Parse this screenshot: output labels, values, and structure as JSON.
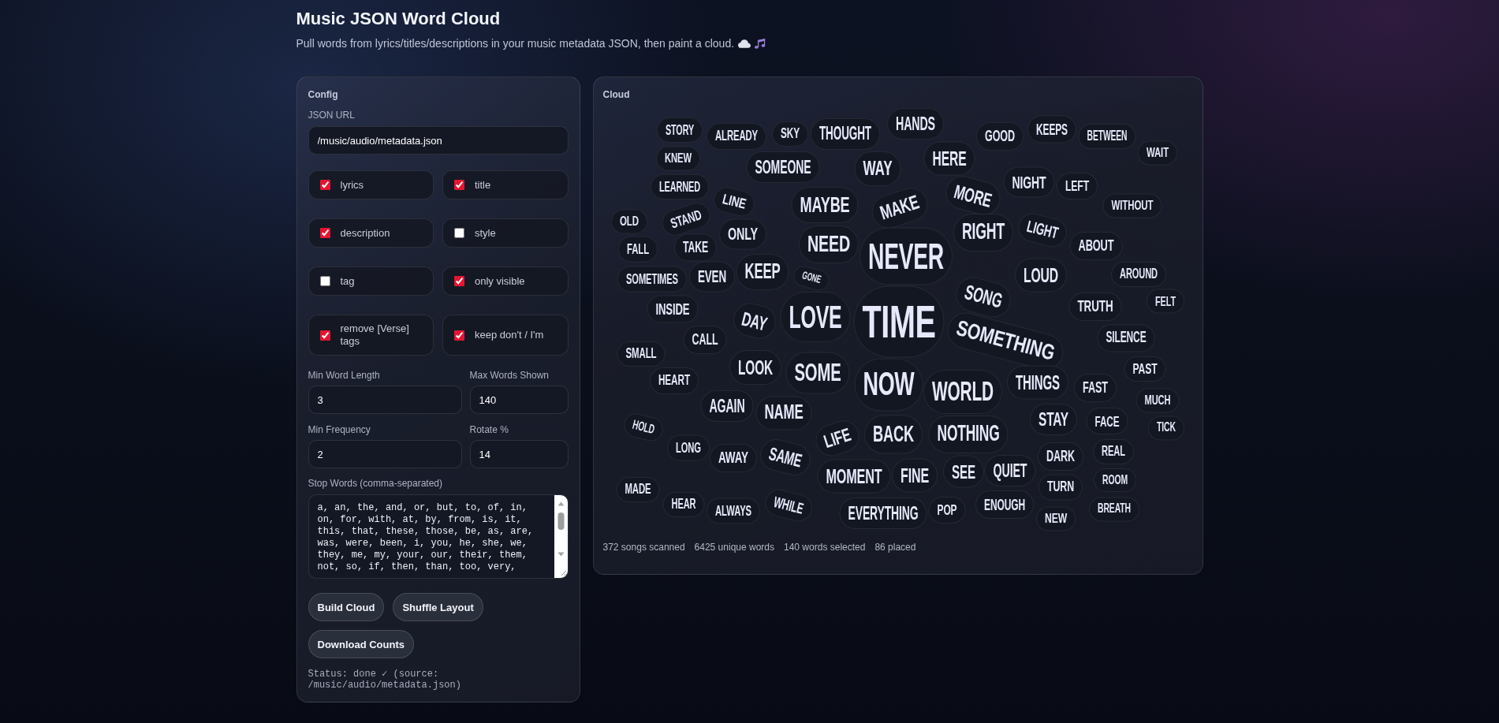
{
  "header": {
    "title": "Music JSON Word Cloud",
    "subtitle": "Pull words from lyrics/titles/descriptions in your music metadata JSON, then paint a cloud."
  },
  "config": {
    "title": "Config",
    "url": {
      "label": "JSON URL",
      "value": "/music/audio/metadata.json"
    },
    "options": [
      {
        "label": "lyrics",
        "checked": true
      },
      {
        "label": "title",
        "checked": true
      },
      {
        "label": "description",
        "checked": true
      },
      {
        "label": "style",
        "checked": false
      },
      {
        "label": "tag",
        "checked": false
      },
      {
        "label": "only visible",
        "checked": true
      },
      {
        "label": "remove [Verse] tags",
        "checked": true
      },
      {
        "label": "keep don't / I'm",
        "checked": true
      }
    ],
    "fields": [
      {
        "label": "Min Word Length",
        "value": "3"
      },
      {
        "label": "Max Words Shown",
        "value": "140"
      },
      {
        "label": "Min Frequency",
        "value": "2"
      },
      {
        "label": "Rotate %",
        "value": "14"
      }
    ],
    "stop_words": {
      "label": "Stop Words (comma-separated)",
      "value": "a, an, the, and, or, but, to, of, in, on, for, with, at, by, from, is, it, this, that, these, those, be, as, are, was, were, been, i, you, he, she, we, they, me, my, your, our, their, them, not, so, if, then, than, too, very,"
    },
    "buttons": [
      "Build Cloud",
      "Shuffle Layout",
      "Download Counts"
    ],
    "status": "Status: done ✓ (source: /music/audio/metadata.json)"
  },
  "cloud": {
    "title": "Cloud",
    "words": [
      {
        "text": "STORY",
        "rotated": false
      },
      {
        "text": "ALREADY",
        "rotated": false
      },
      {
        "text": "SKY",
        "rotated": false
      },
      {
        "text": "THOUGHT",
        "rotated": false
      },
      {
        "text": "HANDS",
        "rotated": false
      },
      {
        "text": "GOOD",
        "rotated": false
      },
      {
        "text": "KEEPS",
        "rotated": false
      },
      {
        "text": "BETWEEN",
        "rotated": false
      },
      {
        "text": "KNEW",
        "rotated": false
      },
      {
        "text": "SOMEONE",
        "rotated": false
      },
      {
        "text": "WAY",
        "rotated": false
      },
      {
        "text": "HERE",
        "rotated": false
      },
      {
        "text": "WAIT",
        "rotated": false
      },
      {
        "text": "LEARNED",
        "rotated": false
      },
      {
        "text": "LINE",
        "rotated": true
      },
      {
        "text": "MAYBE",
        "rotated": false
      },
      {
        "text": "MAKE",
        "rotated": true
      },
      {
        "text": "MORE",
        "rotated": true
      },
      {
        "text": "NIGHT",
        "rotated": false
      },
      {
        "text": "LEFT",
        "rotated": false
      },
      {
        "text": "WITHOUT",
        "rotated": false
      },
      {
        "text": "OLD",
        "rotated": false
      },
      {
        "text": "STAND",
        "rotated": true
      },
      {
        "text": "ONLY",
        "rotated": false
      },
      {
        "text": "RIGHT",
        "rotated": false
      },
      {
        "text": "LIGHT",
        "rotated": true
      },
      {
        "text": "FALL",
        "rotated": false
      },
      {
        "text": "TAKE",
        "rotated": false
      },
      {
        "text": "NEED",
        "rotated": false
      },
      {
        "text": "NEVER",
        "rotated": false
      },
      {
        "text": "ABOUT",
        "rotated": false
      },
      {
        "text": "SOMETIMES",
        "rotated": false
      },
      {
        "text": "EVEN",
        "rotated": false
      },
      {
        "text": "KEEP",
        "rotated": false
      },
      {
        "text": "GONE",
        "rotated": true
      },
      {
        "text": "LOUD",
        "rotated": false
      },
      {
        "text": "AROUND",
        "rotated": false
      },
      {
        "text": "INSIDE",
        "rotated": false
      },
      {
        "text": "DAY",
        "rotated": true
      },
      {
        "text": "LOVE",
        "rotated": false
      },
      {
        "text": "TIME",
        "rotated": false
      },
      {
        "text": "SONG",
        "rotated": true
      },
      {
        "text": "TRUTH",
        "rotated": false
      },
      {
        "text": "FELT",
        "rotated": false
      },
      {
        "text": "SMALL",
        "rotated": false
      },
      {
        "text": "CALL",
        "rotated": false
      },
      {
        "text": "SOMETHING",
        "rotated": true
      },
      {
        "text": "SILENCE",
        "rotated": false
      },
      {
        "text": "HEART",
        "rotated": false
      },
      {
        "text": "LOOK",
        "rotated": false
      },
      {
        "text": "SOME",
        "rotated": false
      },
      {
        "text": "NOW",
        "rotated": false
      },
      {
        "text": "WORLD",
        "rotated": false
      },
      {
        "text": "THINGS",
        "rotated": false
      },
      {
        "text": "FAST",
        "rotated": false
      },
      {
        "text": "PAST",
        "rotated": false
      },
      {
        "text": "MUCH",
        "rotated": false
      },
      {
        "text": "HOLD",
        "rotated": true
      },
      {
        "text": "AGAIN",
        "rotated": false
      },
      {
        "text": "NAME",
        "rotated": false
      },
      {
        "text": "LIFE",
        "rotated": true
      },
      {
        "text": "BACK",
        "rotated": false
      },
      {
        "text": "NOTHING",
        "rotated": false
      },
      {
        "text": "STAY",
        "rotated": false
      },
      {
        "text": "FACE",
        "rotated": false
      },
      {
        "text": "TICK",
        "rotated": false
      },
      {
        "text": "LONG",
        "rotated": false
      },
      {
        "text": "AWAY",
        "rotated": false
      },
      {
        "text": "SAME",
        "rotated": true
      },
      {
        "text": "DARK",
        "rotated": false
      },
      {
        "text": "REAL",
        "rotated": false
      },
      {
        "text": "MADE",
        "rotated": false
      },
      {
        "text": "MOMENT",
        "rotated": false
      },
      {
        "text": "FINE",
        "rotated": false
      },
      {
        "text": "SEE",
        "rotated": false
      },
      {
        "text": "QUIET",
        "rotated": false
      },
      {
        "text": "TURN",
        "rotated": false
      },
      {
        "text": "ROOM",
        "rotated": false
      },
      {
        "text": "HEAR",
        "rotated": false
      },
      {
        "text": "ALWAYS",
        "rotated": false
      },
      {
        "text": "WHILE",
        "rotated": true
      },
      {
        "text": "EVERYTHING",
        "rotated": false
      },
      {
        "text": "POP",
        "rotated": false
      },
      {
        "text": "ENOUGH",
        "rotated": false
      },
      {
        "text": "NEW",
        "rotated": false
      },
      {
        "text": "BREATH",
        "rotated": false
      }
    ],
    "stats": [
      "372 songs scanned",
      "6425 unique words",
      "140 words selected",
      "86 placed"
    ]
  }
}
